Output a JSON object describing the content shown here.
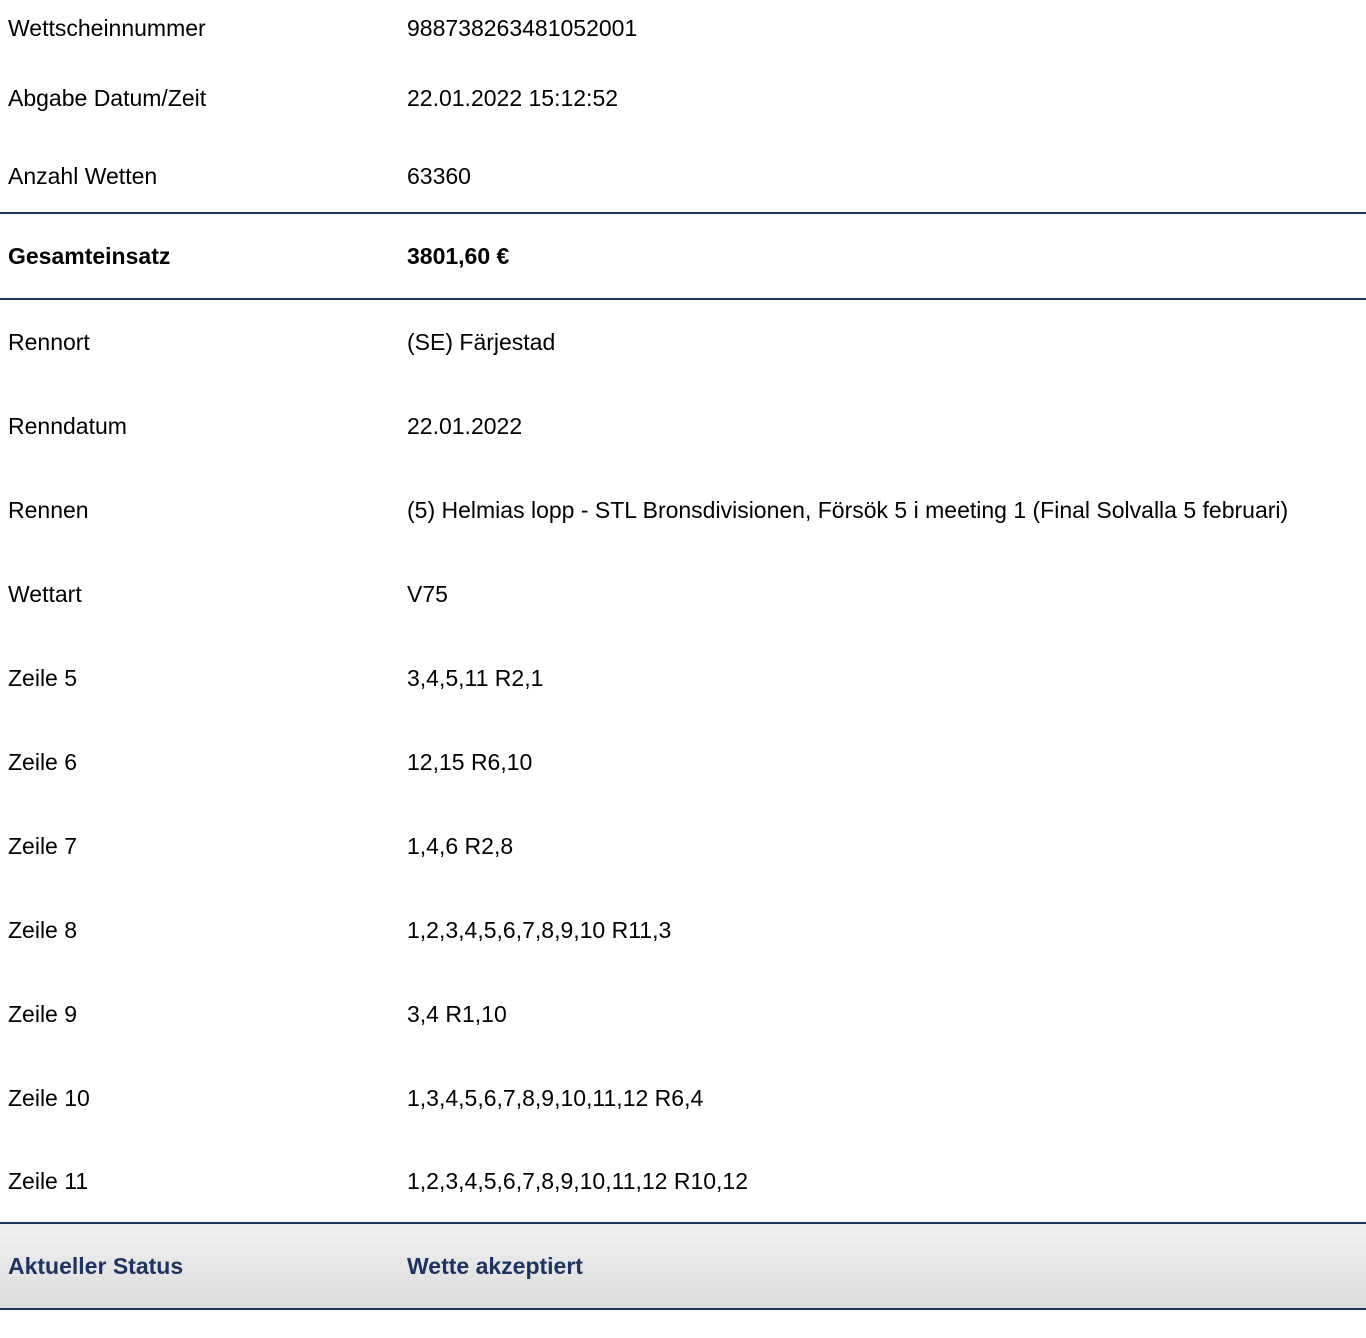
{
  "colors": {
    "accent": "#1d3461",
    "status_bg_top": "#f0f0f0",
    "status_bg_bottom": "#dcdcdc"
  },
  "info": [
    {
      "label": "Wettscheinnummer",
      "value": "988738263481052001"
    },
    {
      "label": "Abgabe Datum/Zeit",
      "value": "22.01.2022 15:12:52"
    },
    {
      "label": "Anzahl Wetten",
      "value": "63360"
    }
  ],
  "total": {
    "label": "Gesamteinsatz",
    "value": "3801,60 €"
  },
  "details": [
    {
      "label": "Rennort",
      "value": "(SE) Färjestad"
    },
    {
      "label": "Renndatum",
      "value": "22.01.2022"
    },
    {
      "label": "Rennen",
      "value": "(5) Helmias lopp - STL Bronsdivisionen, Försök 5 i meeting 1 (Final Solvalla 5 februari)"
    },
    {
      "label": "Wettart",
      "value": "V75"
    },
    {
      "label": "Zeile 5",
      "value": "3,4,5,11 R2,1"
    },
    {
      "label": "Zeile 6",
      "value": "12,15 R6,10"
    },
    {
      "label": "Zeile 7",
      "value": "1,4,6 R2,8"
    },
    {
      "label": "Zeile 8",
      "value": "1,2,3,4,5,6,7,8,9,10 R11,3"
    },
    {
      "label": "Zeile 9",
      "value": "3,4 R1,10"
    },
    {
      "label": "Zeile 10",
      "value": "1,3,4,5,6,7,8,9,10,11,12 R6,4"
    },
    {
      "label": "Zeile 11",
      "value": "1,2,3,4,5,6,7,8,9,10,11,12 R10,12"
    }
  ],
  "status": {
    "label": "Aktueller Status",
    "value": "Wette akzeptiert"
  }
}
